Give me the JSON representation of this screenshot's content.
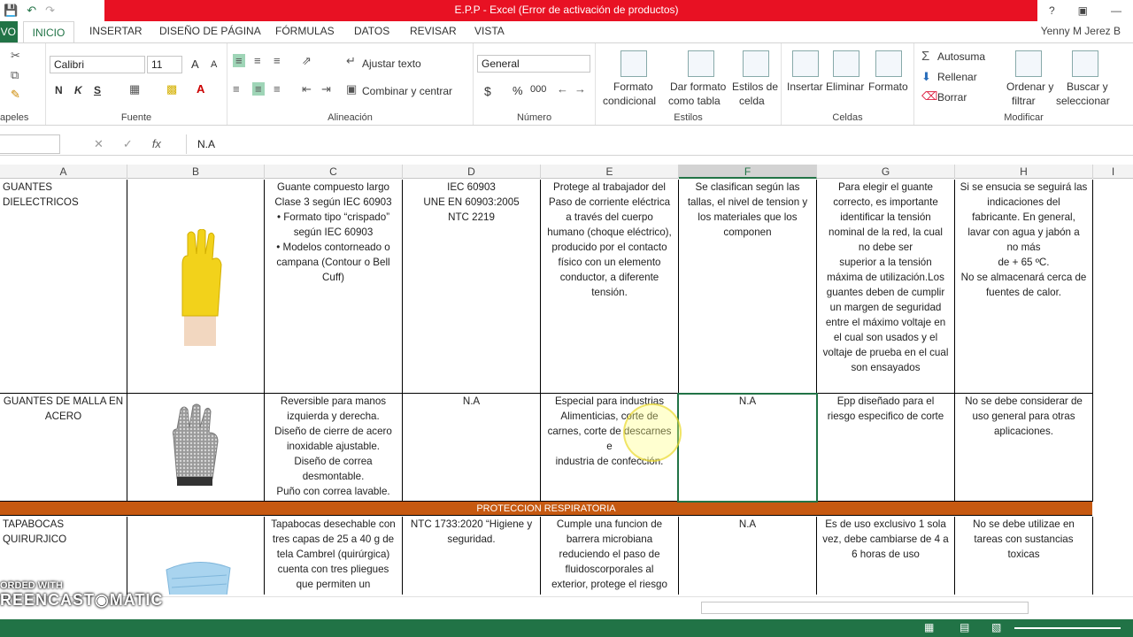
{
  "titlebar": {
    "title": "E.P.P - Excel (Error de activación de productos)",
    "icons": [
      "save-icon",
      "undo-icon",
      "redo-icon"
    ],
    "window_buttons": [
      "?",
      "▣",
      "—",
      "▢",
      "✕"
    ]
  },
  "tabs": {
    "file": "VO",
    "items": [
      "INICIO",
      "INSERTAR",
      "DISEÑO DE PÁGINA",
      "FÓRMULAS",
      "DATOS",
      "REVISAR",
      "VISTA"
    ],
    "user": "Yenny M Jerez B"
  },
  "ribbon": {
    "groups": {
      "clipboard": "apeles",
      "font": "Fuente",
      "alignment": "Alineación",
      "number": "Número",
      "styles": "Estilos",
      "cells": "Celdas",
      "modify": "Modificar"
    },
    "font_name": "Calibri",
    "font_size": "11",
    "grow_font": "A",
    "shrink_font": "A",
    "bold": "N",
    "italic": "K",
    "underline": "S",
    "wrap_text": "Ajustar texto",
    "merge_center": "Combinar y centrar",
    "number_format": "General",
    "currency": "$",
    "percent": "%",
    "thousands": "000",
    "cond_format": [
      "Formato",
      "condicional"
    ],
    "table_format": [
      "Dar formato",
      "como tabla"
    ],
    "cell_styles": [
      "Estilos de",
      "celda"
    ],
    "insert": "Insertar",
    "delete": "Eliminar",
    "format": "Formato",
    "autosum": "Autosuma",
    "fill": "Rellenar",
    "clear": "Borrar",
    "sort_filter": [
      "Ordenar y",
      "filtrar"
    ],
    "find_select": [
      "Buscar y",
      "seleccionar"
    ]
  },
  "formula_bar": {
    "fx": "fx",
    "value": "N.A"
  },
  "columns": [
    "A",
    "B",
    "C",
    "D",
    "E",
    "F",
    "G",
    "H",
    "I"
  ],
  "rows": [
    {
      "a": "GUANTES DIELECTRICOS",
      "c": [
        "Guante compuesto largo",
        "Clase 3 según IEC 60903",
        "• Formato tipo “crispado”",
        "según IEC 60903",
        "• Modelos contorneado o",
        "campana (Contour o Bell",
        "Cuff)"
      ],
      "d": [
        "IEC 60903",
        "UNE EN 60903:2005",
        "NTC 2219"
      ],
      "e": [
        "Protege al trabajador del",
        "Paso de corriente eléctrica",
        "a través del cuerpo",
        "humano (choque eléctrico),",
        "producido por el contacto",
        "físico con un elemento",
        "conductor, a diferente",
        "tensión."
      ],
      "f": [
        "Se clasifican según las",
        "tallas, el nivel de tension y",
        "los materiales que los",
        "componen"
      ],
      "g": [
        "Para elegir el guante",
        "correcto, es importante",
        "identificar la tensión",
        "nominal de la red, la cual",
        "no debe ser",
        "superior a la tensión",
        "máxima de utilización.Los",
        "guantes deben de cumplir",
        "un margen de seguridad",
        "entre el máximo voltaje en",
        "el cual son usados y el",
        "voltaje de prueba en el cual",
        "son ensayados"
      ],
      "h": [
        "Si se ensucia se seguirá las",
        "indicaciones del",
        "fabricante. En general,",
        "lavar con agua y jabón a",
        "no más",
        "de + 65 ºC.",
        "No se almacenará cerca de",
        "fuentes de calor."
      ]
    },
    {
      "a": [
        "GUANTES DE MALLA EN",
        "ACERO"
      ],
      "c": [
        "Reversible para manos",
        "izquierda y derecha.",
        "Diseño de cierre de acero",
        "inoxidable ajustable.",
        "Diseño de correa",
        "desmontable.",
        "Puño con correa lavable."
      ],
      "d": [
        "N.A"
      ],
      "e": [
        "Especial para industrias",
        "Alimenticias, corte de",
        "carnes, corte de descarnes e",
        "industria de confección."
      ],
      "f": [
        "N.A"
      ],
      "g": [
        "Epp diseñado para el",
        "riesgo especifico de corte"
      ],
      "h": [
        "No se debe considerar de",
        "uso general para otras",
        "aplicaciones."
      ]
    }
  ],
  "section_header": "PROTECCION RESPIRATORIA",
  "row3": {
    "a": "TAPABOCAS QUIRURJICO",
    "c": [
      "Tapabocas desechable con",
      "tres capas de 25 a 40 g de",
      "tela Cambrel (quirúrgica)",
      "cuenta con tres pliegues",
      "que permiten un"
    ],
    "d": [
      "NTC 1733:2020 “Higiene y",
      "seguridad."
    ],
    "e": [
      "Cumple una funcion de",
      "barrera microbiana",
      "reduciendo el paso de",
      "fluidoscorporales al",
      "exterior, protege el riesgo"
    ],
    "f": [
      "N.A"
    ],
    "g": [
      "Es de uso exclusivo 1 sola",
      "vez, debe cambiarse de 4 a",
      "6 horas de uso"
    ],
    "h": [
      "No se debe utilizae en",
      "tareas con sustancias",
      "toxicas"
    ]
  },
  "watermark": [
    "ORDED WITH",
    "REENCAST",
    "MATIC"
  ],
  "colors": {
    "excel_green": "#217346",
    "title_red": "#e81123",
    "section_orange": "#c65911"
  }
}
